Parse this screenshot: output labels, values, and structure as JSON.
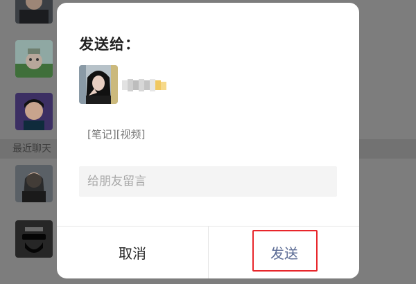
{
  "background": {
    "section_label": "最近聊天"
  },
  "dialog": {
    "title": "发送给：",
    "recipient": {
      "name": ""
    },
    "content_tag": "[笔记][视频]",
    "message_placeholder": "给朋友留言",
    "cancel_label": "取消",
    "send_label": "发送"
  },
  "colors": {
    "overlay": "#7d7d7d",
    "dialog_bg": "#ffffff",
    "send_text": "#5b6b94",
    "highlight_border": "#e8262b"
  }
}
